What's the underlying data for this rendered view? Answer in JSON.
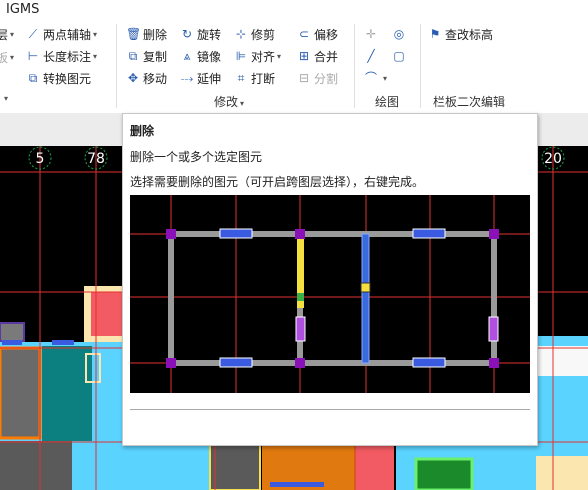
{
  "app": {
    "title": "IGMS"
  },
  "ribbon": {
    "col0": {
      "item1": "层",
      "item2": "板"
    },
    "col1": {
      "item1": "两点辅轴",
      "item2": "长度标注",
      "item3": "转换图元"
    },
    "edit": {
      "delete": "删除",
      "copy": "复制",
      "move": "移动",
      "rotate": "旋转",
      "mirror": "镜像",
      "extend": "延伸",
      "trim": "修剪",
      "align": "对齐",
      "break": "打断",
      "offset": "偏移",
      "merge": "合并",
      "split": "分割"
    },
    "groups": {
      "modify": "修改",
      "draw": "绘图",
      "railing": "栏板二次编辑"
    },
    "railing": {
      "edit_elevation": "查改标高"
    }
  },
  "canvas": {
    "axis_labels": [
      "5",
      "78",
      "20"
    ]
  },
  "tooltip": {
    "title": "删除",
    "desc1": "删除一个或多个选定图元",
    "desc2": "选择需要删除的图元（可开启跨图层选择），右键完成。"
  }
}
